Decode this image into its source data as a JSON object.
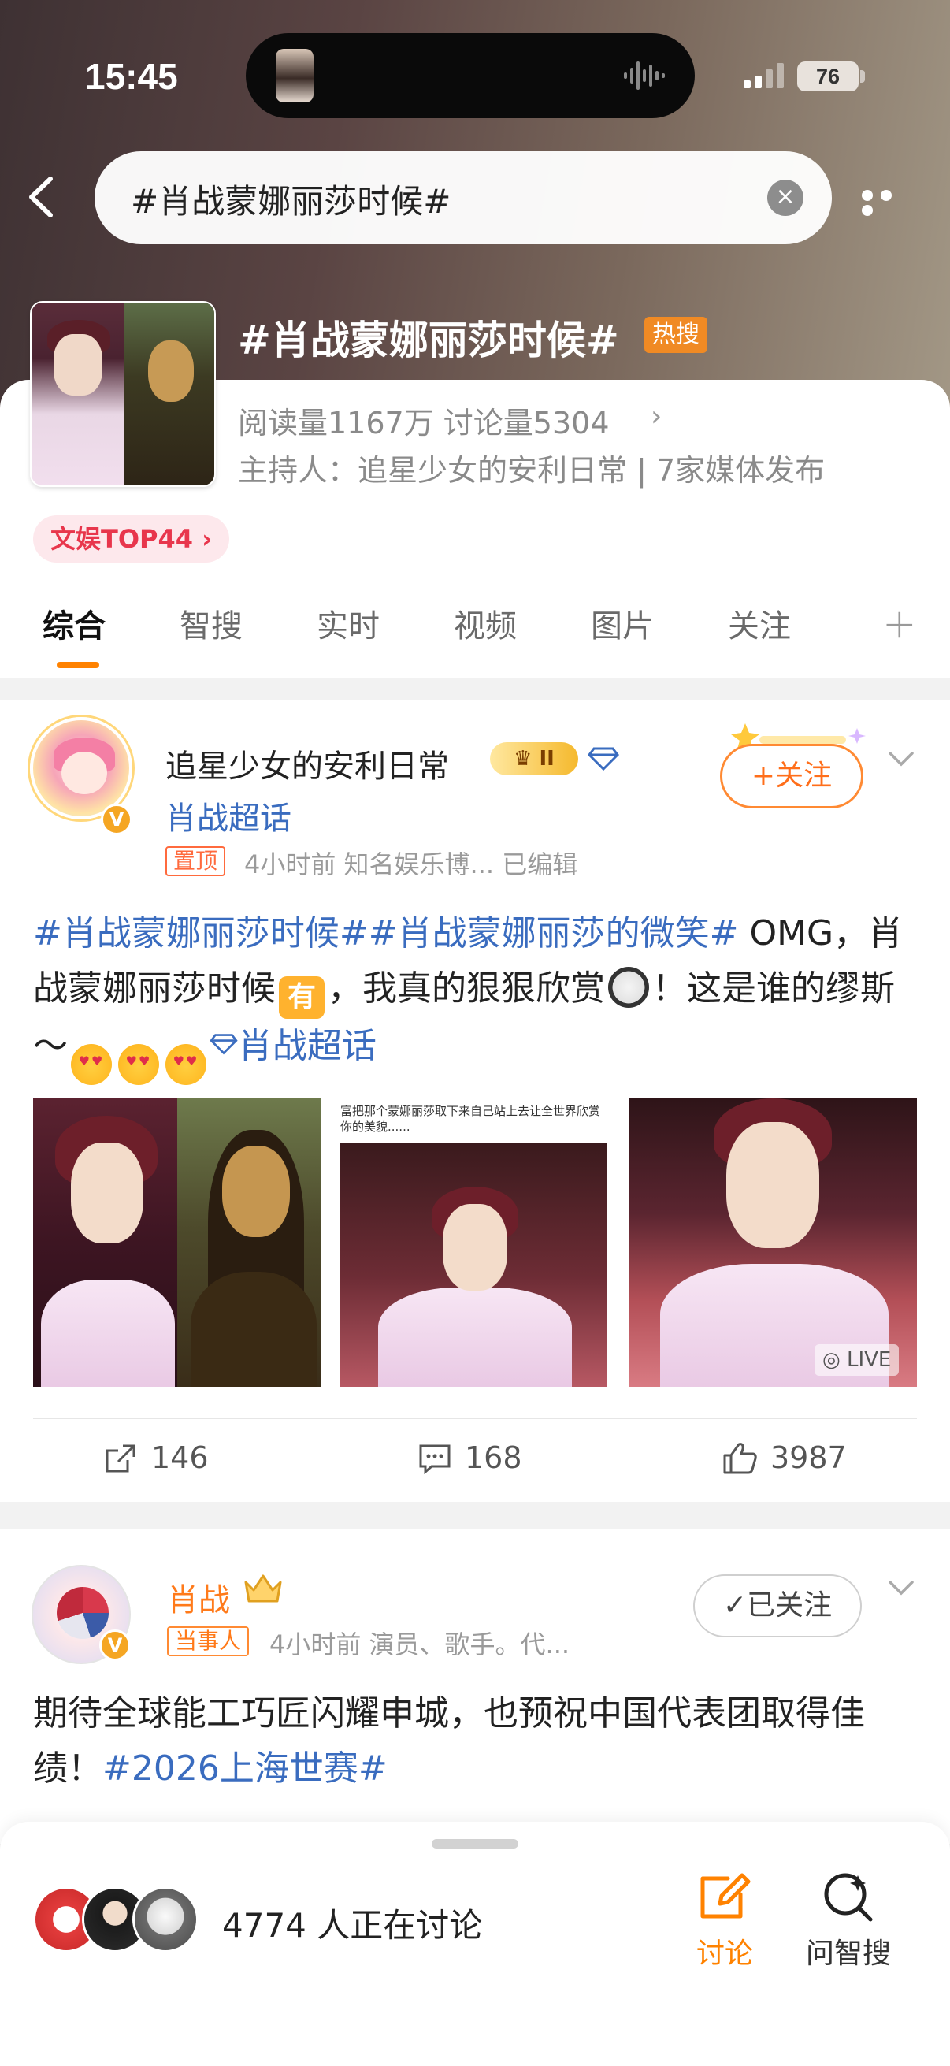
{
  "status_bar": {
    "time": "15:45",
    "battery": "76"
  },
  "search": {
    "query": "#肖战蒙娜丽莎时候#",
    "clear": "×"
  },
  "topic": {
    "title": "#肖战蒙娜丽莎时候#",
    "hot_badge": "热搜",
    "stats": "阅读量1167万  讨论量5304",
    "stats_arrow": "›",
    "host": "主持人：追星少女的安利日常 | 7家媒体发布",
    "rank": "文娱TOP44 ›"
  },
  "tabs": [
    "综合",
    "智搜",
    "实时",
    "视频",
    "图片",
    "关注"
  ],
  "tab_plus": "+",
  "post1": {
    "author": "追星少女的安利日常",
    "crown_level": "II",
    "supertopic": "肖战超话",
    "pin": "置顶",
    "meta": "4小时前   知名娱乐博...   已编辑",
    "follow": "+关注",
    "text_link1": "#肖战蒙娜丽莎时候##肖战蒙娜丽莎的微笑#",
    "text_a": " OMG，肖战蒙娜丽莎时候",
    "emoji_you": "有",
    "text_b": "，我真的狠狠欣赏",
    "text_c": "！这是谁的缪斯～",
    "text_link2": "肖战超话",
    "image2_caption": "富把那个蒙娜丽莎取下来自己站上去让全世界欣赏你的美貌......",
    "live": "LIVE",
    "reposts": "146",
    "comments": "168",
    "likes": "3987"
  },
  "post2": {
    "author": "肖战",
    "tag": "当事人",
    "meta": "4小时前   演员、歌手。代...",
    "follow": "✓已关注",
    "text": "期待全球能工巧匠闪耀申城，也预祝中国代表团取得佳绩！",
    "text_link": "#2026上海世赛#"
  },
  "bottom": {
    "discussing": "4774 人正在讨论",
    "discuss": "讨论",
    "zhisou": "问智搜"
  },
  "colors": {
    "accent": "#ff8200",
    "link": "#3a6cbf",
    "hot": "#f08a24"
  }
}
